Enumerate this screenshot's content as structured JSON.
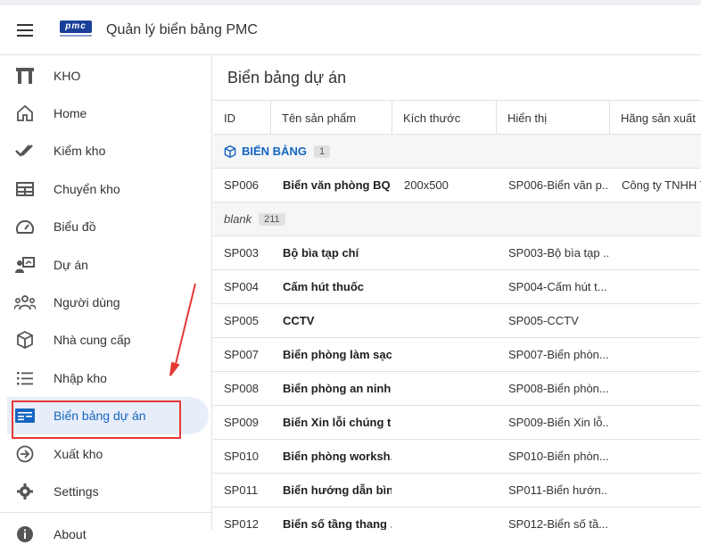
{
  "app": {
    "title": "Quản lý biển bảng PMC",
    "logo_text": "pmc"
  },
  "sidebar": {
    "items": [
      {
        "label": "KHO",
        "icon": "warehouse-icon"
      },
      {
        "label": "Home",
        "icon": "home-icon"
      },
      {
        "label": "Kiểm kho",
        "icon": "double-check-icon"
      },
      {
        "label": "Chuyển kho",
        "icon": "table-icon"
      },
      {
        "label": "Biểu đồ",
        "icon": "speedometer-icon"
      },
      {
        "label": "Dự án",
        "icon": "presenter-icon"
      },
      {
        "label": "Người dùng",
        "icon": "people-icon"
      },
      {
        "label": "Nhà cung cấp",
        "icon": "box-icon"
      },
      {
        "label": "Nhập kho",
        "icon": "list-icon"
      },
      {
        "label": "Biển bảng dự án",
        "icon": "card-list-icon",
        "active": true
      },
      {
        "label": "Xuất kho",
        "icon": "arrow-circle-icon"
      },
      {
        "label": "Settings",
        "icon": "gear-icon"
      },
      {
        "label": "About",
        "icon": "info-icon"
      }
    ]
  },
  "main": {
    "title": "Biển bảng dự án",
    "columns": [
      "ID",
      "Tên sản phẩm",
      "Kích thước",
      "Hiển thị",
      "Hãng sản xuất"
    ],
    "groups": [
      {
        "name": "BIẾN BẢNG",
        "count": "1",
        "rows": [
          {
            "id": "SP006",
            "name": "Biển văn phòng BQL",
            "size": "200x500",
            "display": "SP006-Biển văn p...",
            "maker": "Công ty TNHH T"
          }
        ]
      },
      {
        "name": "blank",
        "count": "211",
        "rows": [
          {
            "id": "SP003",
            "name": "Bộ bìa tạp chí",
            "size": "",
            "display": "SP003-Bộ bìa tạp ...",
            "maker": ""
          },
          {
            "id": "SP004",
            "name": "Cấm hút thuốc",
            "size": "",
            "display": "SP004-Cấm hút t...",
            "maker": ""
          },
          {
            "id": "SP005",
            "name": "CCTV",
            "size": "",
            "display": "SP005-CCTV",
            "maker": ""
          },
          {
            "id": "SP007",
            "name": "Biển phòng làm sạch",
            "size": "",
            "display": "SP007-Biển phòn...",
            "maker": ""
          },
          {
            "id": "SP008",
            "name": "Biển phòng an ninh",
            "size": "",
            "display": "SP008-Biển phòn...",
            "maker": ""
          },
          {
            "id": "SP009",
            "name": "Biển Xin lỗi chúng t...",
            "size": "",
            "display": "SP009-Biển Xin lỗ...",
            "maker": ""
          },
          {
            "id": "SP010",
            "name": "Biển phòng worksh...",
            "size": "",
            "display": "SP010-Biển phòn...",
            "maker": ""
          },
          {
            "id": "SP011",
            "name": "Biển hướng dẫn bìn...",
            "size": "",
            "display": "SP011-Biển hướn...",
            "maker": ""
          },
          {
            "id": "SP012",
            "name": "Biển số tầng thang ...",
            "size": "",
            "display": "SP012-Biển số tầ...",
            "maker": ""
          }
        ]
      }
    ]
  },
  "colors": {
    "accent": "#1565c0",
    "active_bg": "#e8eef9",
    "annotation": "#e53935",
    "logo": "#1a3f9a"
  }
}
